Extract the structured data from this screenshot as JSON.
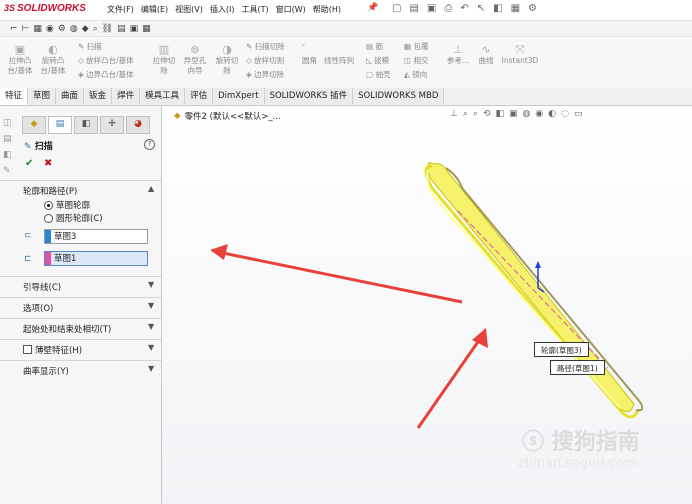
{
  "app": {
    "logo_ds": "3S",
    "logo_text": "SOLIDWORKS",
    "menu": [
      "文件(F)",
      "编辑(E)",
      "视图(V)",
      "插入(I)",
      "工具(T)",
      "窗口(W)",
      "帮助(H)"
    ]
  },
  "ribbon": {
    "big": [
      {
        "label": "拉伸凸\n台/基体",
        "icon": "cube-icon"
      },
      {
        "label": "旋转凸\n台/基体",
        "icon": "revolve-icon"
      },
      {
        "label": "拉伸切\n除",
        "icon": "extrude-cut-icon"
      },
      {
        "label": "异型孔\n向导",
        "icon": "hole-icon"
      },
      {
        "label": "旋转切\n除",
        "icon": "revolve-cut-icon"
      }
    ],
    "small_left": [
      "扫描",
      "放样凸台/基体",
      "边界凸台/基体"
    ],
    "small_mid": [
      "扫描切除",
      "放样切割",
      "边界切除"
    ],
    "small_right": [
      [
        "圆角",
        "线性阵列"
      ],
      [
        "筋",
        "拔模",
        "抽壳"
      ],
      [
        "包覆",
        "相交",
        "镜向"
      ]
    ],
    "extra": [
      "参考...",
      "曲线",
      "Instant3D"
    ]
  },
  "tabs": [
    "特征",
    "草图",
    "曲面",
    "钣金",
    "焊件",
    "模具工具",
    "评估",
    "DimXpert",
    "SOLIDWORKS 插件",
    "SOLIDWORKS MBD"
  ],
  "panel": {
    "title": "扫描",
    "help": "?",
    "ok": "✔",
    "cancel": "✖",
    "section_profile": "轮廓和路径(P)",
    "radio_sketch": "草图轮廓",
    "radio_circle": "圆形轮廓(C)",
    "profile_value": "草图3",
    "path_value": "草图1",
    "sections": [
      "引导线(C)",
      "选项(O)",
      "起始处和结束处相切(T)",
      "薄壁特征(H)",
      "曲率显示(Y)"
    ]
  },
  "viewport": {
    "tree_label": "零件2 (默认<<默认>_...",
    "callout_profile": "轮廓(草图3)",
    "callout_path": "路径(草图1)",
    "watermark": "搜狗指南",
    "watermark_url": "zhinan.sogou.com"
  },
  "colors": {
    "profile_bar": "#2e7fd6",
    "path_bar": "#e44fa6",
    "arrow": "#e8403a",
    "highlight": "#f2f23a"
  }
}
